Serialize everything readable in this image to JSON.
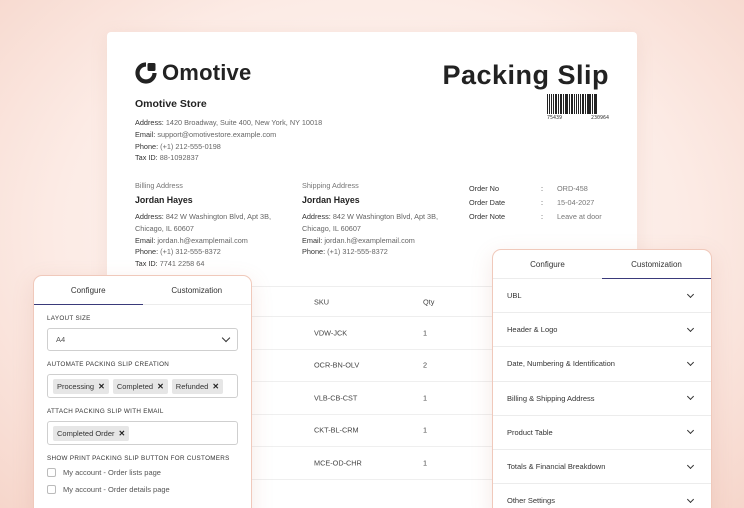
{
  "document": {
    "brand": "Omotive",
    "title": "Packing Slip",
    "barcode_number_left": "75439",
    "barcode_number_right": "230964",
    "store": {
      "name": "Omotive Store",
      "address_label": "Address:",
      "address": "1420 Broadway, Suite 400, New York, NY 10018",
      "email_label": "Email:",
      "email": "support@omotivestore.example.com",
      "phone_label": "Phone:",
      "phone": "(+1) 212-555-0198",
      "tax_label": "Tax ID:",
      "tax": "88-1092837"
    },
    "billing": {
      "title": "Billing Address",
      "name": "Jordan Hayes",
      "address_label": "Address:",
      "address": "842 W Washington Blvd, Apt 3B, Chicago, IL 60607",
      "email_label": "Email:",
      "email": "jordan.h@examplemail.com",
      "phone_label": "Phone:",
      "phone": "(+1) 312-555-8372",
      "tax_label": "Tax ID:",
      "tax": "7741 2258 64"
    },
    "shipping": {
      "title": "Shipping Address",
      "name": "Jordan Hayes",
      "address_label": "Address:",
      "address": "842 W Washington Blvd, Apt 3B, Chicago, IL 60607",
      "email_label": "Email:",
      "email": "jordan.h@examplemail.com",
      "phone_label": "Phone:",
      "phone": "(+1) 312-555-8372"
    },
    "order": {
      "no_label": "Order No",
      "no": "ORD-458",
      "date_label": "Order Date",
      "date": "15-04-2027",
      "note_label": "Order Note",
      "note": "Leave at door",
      "separator": ":"
    },
    "table": {
      "headers": {
        "sku": "SKU",
        "qty": "Qty"
      },
      "rows": [
        {
          "sku": "VDW-JCK",
          "qty": "1"
        },
        {
          "sku": "OCR-BN-OLV",
          "qty": "2"
        },
        {
          "sku": "VLB-CB-CST",
          "qty": "1"
        },
        {
          "sku": "CKT-BL-CRM",
          "qty": "1"
        },
        {
          "sku": "MCE-OD-CHR",
          "qty": "1"
        }
      ]
    }
  },
  "left_panel": {
    "tabs": {
      "configure": "Configure",
      "customization": "Customization"
    },
    "active_tab": "configure",
    "layout_size_label": "LAYOUT SIZE",
    "layout_size_value": "A4",
    "automate_label": "AUTOMATE PACKING SLIP CREATION",
    "automate_tags": [
      "Processing",
      "Completed",
      "Refunded"
    ],
    "attach_label": "ATTACH PACKING SLIP WITH EMAIL",
    "attach_tags": [
      "Completed Order"
    ],
    "show_button_label": "SHOW PRINT PACKING SLIP BUTTON FOR CUSTOMERS",
    "checkboxes": [
      {
        "label": "My account - Order lists page",
        "checked": false
      },
      {
        "label": "My account - Order details page",
        "checked": false
      }
    ],
    "tag_remove_glyph": "✕"
  },
  "right_panel": {
    "tabs": {
      "configure": "Configure",
      "customization": "Customization"
    },
    "active_tab": "customization",
    "sections": [
      "UBL",
      "Header & Logo",
      "Date, Numbering & Identification",
      "Billing & Shipping Address",
      "Product Table",
      "Totals & Financial Breakdown",
      "Other Settings"
    ]
  },
  "colors": {
    "accent_tab_underline": "#3a3a7a",
    "panel_border": "#f0c9bb",
    "background": "#fcebe5"
  }
}
